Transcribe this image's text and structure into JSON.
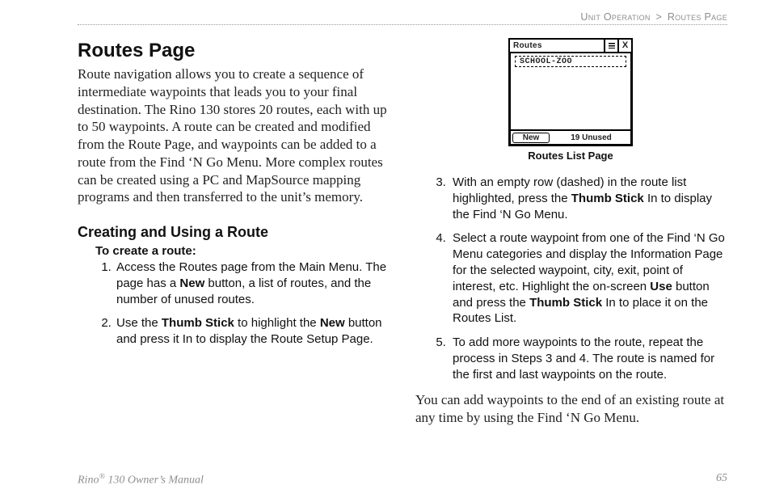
{
  "breadcrumb": {
    "section": "Unit Operation",
    "sep": ">",
    "page": "Routes Page"
  },
  "title": "Routes Page",
  "intro": "Route navigation allows you to create a sequence of intermediate waypoints that leads you to your final destination. The Rino 130 stores 20 routes, each with up to 50 waypoints. A route can be created and modified from the Route Page, and waypoints can be added to a route from the Find ‘N Go Menu. More complex routes can be created using a PC and MapSource mapping programs and then transferred to the unit’s memory.",
  "subtitle": "Creating and Using a Route",
  "step_heading": "To create a route:",
  "steps_left": [
    {
      "pre": "Access the Routes page from the Main Menu. The page has a ",
      "b1": "New",
      "post": " button, a list of routes, and the number of unused routes."
    },
    {
      "pre": "Use the ",
      "b1": "Thumb Stick",
      "mid": " to highlight the ",
      "b2": "New",
      "post": " button and press it In to display the Route Setup Page."
    }
  ],
  "device": {
    "title": "Routes",
    "row": "SCHOOL-ZOO",
    "new_btn": "New",
    "status": "19 Unused",
    "caption": "Routes List Page"
  },
  "steps_right": [
    {
      "pre": "With an empty row (dashed) in the route list highlighted, press the ",
      "b1": "Thumb Stick",
      "post": " In to display the Find ‘N Go Menu."
    },
    {
      "pre": "Select a route waypoint from one of the Find ‘N Go Menu categories and display the Information Page for the selected waypoint, city, exit, point of interest, etc. Highlight the on-screen ",
      "b1": "Use",
      "mid": " button and press the ",
      "b2": "Thumb Stick",
      "post": " In to place it on the Routes List."
    },
    {
      "pre": "To add more waypoints to the route, repeat the process in Steps 3 and 4. The route is named for the first and last waypoints on the route.",
      "b1": "",
      "post": ""
    }
  ],
  "closing": "You can add waypoints to the end of an existing route at any time by using the Find ‘N Go Menu.",
  "footer": {
    "left_pre": "Rino",
    "left_sup": "®",
    "left_post": " 130 Owner’s Manual",
    "page_no": "65"
  }
}
